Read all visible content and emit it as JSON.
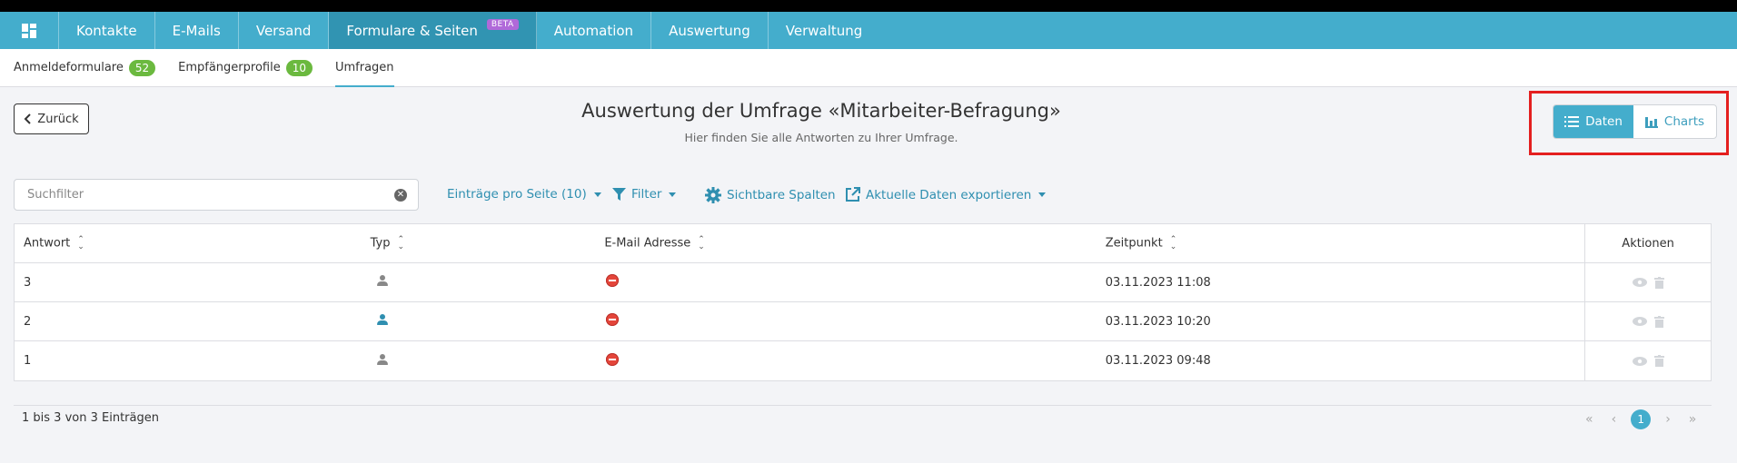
{
  "topnav": {
    "items": [
      {
        "label": "Kontakte"
      },
      {
        "label": "E-Mails"
      },
      {
        "label": "Versand"
      },
      {
        "label": "Formulare & Seiten",
        "badge": "BETA",
        "active": true
      },
      {
        "label": "Automation"
      },
      {
        "label": "Auswertung"
      },
      {
        "label": "Verwaltung"
      }
    ]
  },
  "subnav": {
    "items": [
      {
        "label": "Anmeldeformulare",
        "count": "52"
      },
      {
        "label": "Empfängerprofile",
        "count": "10"
      },
      {
        "label": "Umfragen",
        "active": true
      }
    ]
  },
  "header": {
    "back_label": "Zurück",
    "title": "Auswertung der Umfrage «Mitarbeiter-Befragung»",
    "subtitle": "Hier finden Sie alle Antworten zu Ihrer Umfrage."
  },
  "view_toggle": {
    "data_label": "Daten",
    "charts_label": "Charts"
  },
  "toolbar": {
    "search_placeholder": "Suchfilter",
    "per_page_label": "Einträge pro Seite (10)",
    "filter_label": "Filter",
    "columns_label": "Sichtbare Spalten",
    "export_label": "Aktuelle Daten exportieren"
  },
  "table": {
    "headers": {
      "answer": "Antwort",
      "type": "Typ",
      "email": "E-Mail Adresse",
      "time": "Zeitpunkt",
      "actions": "Aktionen"
    },
    "rows": [
      {
        "answer": "3",
        "time": "03.11.2023 11:08",
        "type_icon_color": "#888888"
      },
      {
        "answer": "2",
        "time": "03.11.2023 10:20",
        "type_icon_color": "#2f8fb0"
      },
      {
        "answer": "1",
        "time": "03.11.2023 09:48",
        "type_icon_color": "#888888"
      }
    ]
  },
  "footer": {
    "info": "1 bis 3 von 3 Einträgen",
    "first": "«",
    "prev": "‹",
    "current_page": "1",
    "next": "›",
    "last": "»"
  },
  "colors": {
    "accent": "#44adcc",
    "active_nav": "#3194b2",
    "badge_green": "#6bb93f",
    "beta_purple": "#b069d9",
    "highlight_red": "#e41f1f"
  }
}
